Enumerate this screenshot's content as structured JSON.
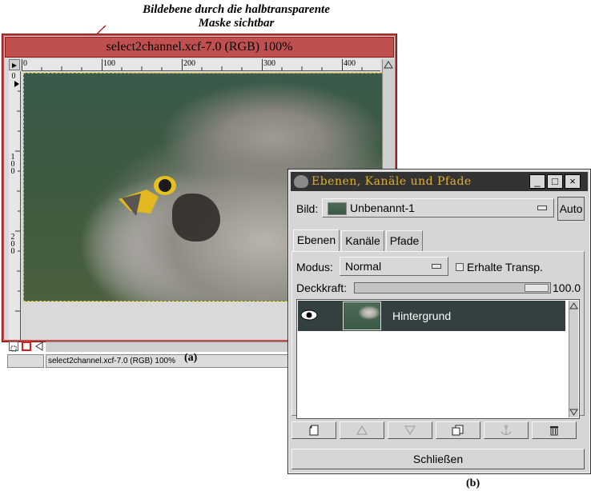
{
  "annotation": {
    "line1": "Bildebene durch die halbtransparente",
    "line2": "Maske sichtbar"
  },
  "caption_a": "(a)",
  "caption_b": "(b)",
  "image_window": {
    "title": "select2channel.xcf-7.0 (RGB) 100%",
    "ruler_h_labels": [
      "0",
      "100",
      "200",
      "300",
      "400"
    ],
    "ruler_v_labels": [
      "0",
      "100",
      "200"
    ],
    "status_text": "select2channel.xcf-7.0 (RGB) 100%"
  },
  "layers_dialog": {
    "title": "Ebenen, Kanäle und Pfade",
    "window_buttons": [
      "_",
      "□",
      "×"
    ],
    "image_label": "Bild:",
    "image_value": "Unbenannt-1",
    "auto_label": "Auto",
    "tabs": [
      "Ebenen",
      "Kanäle",
      "Pfade"
    ],
    "active_tab": "Ebenen",
    "mode_label": "Modus:",
    "mode_value": "Normal",
    "keep_trans_label": "Erhalte Transp.",
    "keep_trans_checked": false,
    "opacity_label": "Deckkraft:",
    "opacity_value": "100.0",
    "opacity_fraction": 1.0,
    "layers": [
      {
        "name": "Hintergrund",
        "visible": true,
        "selected": true
      }
    ],
    "toolbar_icons": [
      "new-layer-icon",
      "raise-layer-icon",
      "lower-layer-icon",
      "duplicate-layer-icon",
      "anchor-layer-icon",
      "delete-layer-icon"
    ],
    "close_label": "Schließen"
  },
  "colors": {
    "image_title_bg": "#c0504f",
    "dialog_title_bg": "#333333",
    "dialog_title_fg": "#e0b030",
    "selected_layer_bg": "#344040"
  }
}
